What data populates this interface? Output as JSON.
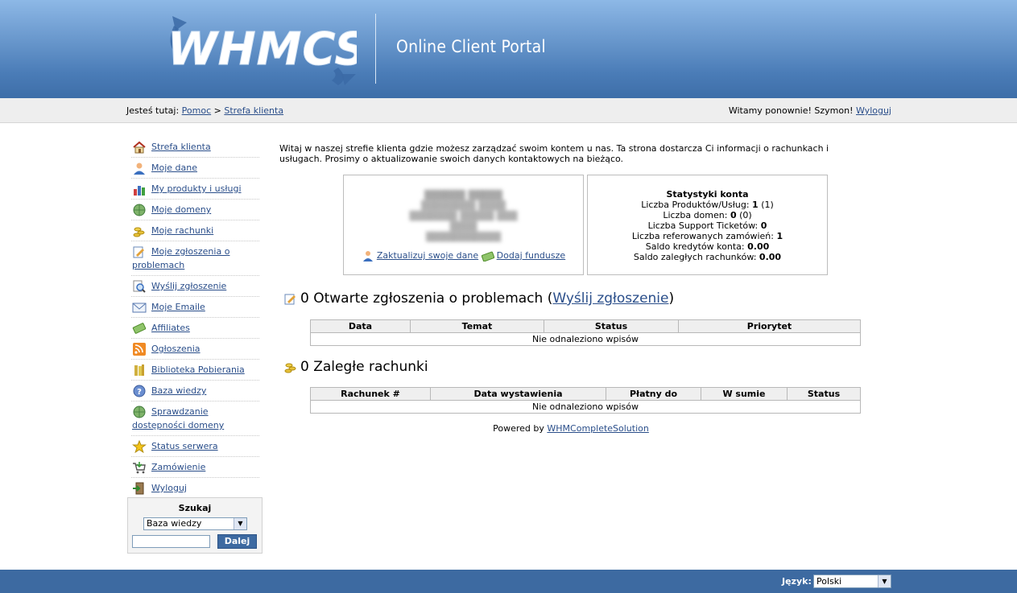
{
  "header": {
    "logo_text": "WHMCS",
    "portal_title": "Online Client Portal"
  },
  "breadcrumb": {
    "prefix": "Jesteś tutaj:",
    "items": [
      "Pomoc",
      "Strefa klienta"
    ],
    "separator": ">"
  },
  "welcome": {
    "text": "Witamy ponownie! Szymon!",
    "logout": "Wyloguj"
  },
  "sidebar": {
    "items": [
      {
        "label": "Strefa klienta",
        "icon": "home-icon"
      },
      {
        "label": "Moje dane",
        "icon": "user-icon"
      },
      {
        "label": "My produkty i usługi",
        "icon": "bar-chart-icon"
      },
      {
        "label": "Moje domeny",
        "icon": "globe-icon"
      },
      {
        "label": "Moje rachunki",
        "icon": "coins-icon"
      },
      {
        "label": "Moje zgłoszenia o problemach",
        "icon": "ticket-icon"
      },
      {
        "label": "Wyślij zgłoszenie",
        "icon": "magnifier-icon"
      },
      {
        "label": "Moje Emaile",
        "icon": "envelope-icon"
      },
      {
        "label": "Affiliates",
        "icon": "money-icon"
      },
      {
        "label": "Ogłoszenia",
        "icon": "rss-icon"
      },
      {
        "label": "Biblioteka Pobierania",
        "icon": "books-icon"
      },
      {
        "label": "Baza wiedzy",
        "icon": "help-icon"
      },
      {
        "label": "Sprawdzanie dostępności domeny",
        "icon": "globe-icon"
      },
      {
        "label": "Status serwera",
        "icon": "star-icon"
      },
      {
        "label": "Zamówienie",
        "icon": "cart-icon"
      },
      {
        "label": "Wyloguj",
        "icon": "logout-icon"
      }
    ]
  },
  "search": {
    "title": "Szukaj",
    "selected": "Baza wiedzy",
    "input_value": "",
    "button": "Dalej"
  },
  "main": {
    "intro": "Witaj w naszej strefie klienta gdzie możesz zarządzać swoim kontem u nas. Ta strona dostarcza Ci informacji o rachunkach i usługach. Prosimy o aktualizowanie swoich danych kontaktowych na bieżąco.",
    "client_links": {
      "update": "Zaktualizuj swoje dane",
      "add_funds": "Dodaj fundusze"
    },
    "stats": {
      "title": "Statystyki konta",
      "rows": [
        {
          "label": "Liczba Produktów/Usług:",
          "value": "1",
          "extra": " (1)"
        },
        {
          "label": "Liczba domen:",
          "value": "0",
          "extra": " (0)"
        },
        {
          "label": "Liczba Support Ticketów:",
          "value": "0",
          "extra": ""
        },
        {
          "label": "Liczba referowanych zamówień:",
          "value": "1",
          "extra": ""
        },
        {
          "label": "Saldo kredytów konta:",
          "value": "0.00",
          "extra": ""
        },
        {
          "label": "Saldo zaległych rachunków:",
          "value": "0.00",
          "extra": ""
        }
      ]
    },
    "tickets": {
      "count_title": "0 Otwarte zgłoszenia o problemach (",
      "link": "Wyślij zgłoszenie",
      "close": ")",
      "columns": [
        "Data",
        "Temat",
        "Status",
        "Priorytet"
      ],
      "empty": "Nie odnaleziono wpisów"
    },
    "invoices": {
      "title": "0 Zaległe rachunki",
      "columns": [
        "Rachunek #",
        "Data wystawienia",
        "Płatny do",
        "W sumie",
        "Status"
      ],
      "empty": "Nie odnaleziono wpisów"
    },
    "powered_by": {
      "prefix": "Powered by",
      "link": "WHMCompleteSolution"
    }
  },
  "footer": {
    "language_label": "Język:",
    "language": "Polski"
  },
  "colors": {
    "header_blue": "#4a7cb7",
    "footer_blue": "#3d6aa1",
    "link": "#2a4e8a"
  }
}
